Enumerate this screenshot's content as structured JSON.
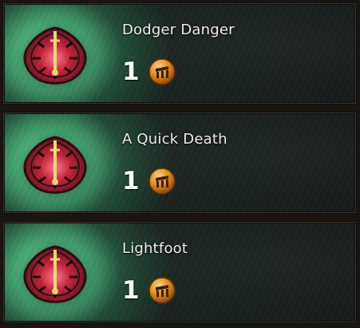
{
  "achievements": [
    {
      "title": "Dodger Danger",
      "reward_count": "1",
      "emblem_icon": "shielded-dagger-emblem-icon",
      "reward_icon": "achievement-point-coin-icon"
    },
    {
      "title": "A Quick Death",
      "reward_count": "1",
      "emblem_icon": "shielded-dagger-emblem-icon",
      "reward_icon": "achievement-point-coin-icon"
    },
    {
      "title": "Lightfoot",
      "reward_count": "1",
      "emblem_icon": "shielded-dagger-emblem-icon",
      "reward_icon": "achievement-point-coin-icon"
    }
  ],
  "colors": {
    "glow": "#7fe9b0",
    "panel_dark": "#171d1b",
    "emblem_red": "#b5283b",
    "coin_orange": "#e48a14"
  }
}
